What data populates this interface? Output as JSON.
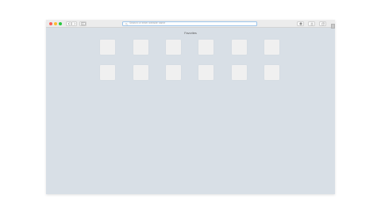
{
  "toolbar": {
    "address_placeholder": "Search or enter website name",
    "icons": {
      "close": "close-light",
      "minimize": "minimize-light",
      "zoom": "zoom-light",
      "back": "chevron-left-icon",
      "forward": "chevron-right-icon",
      "sidebar": "sidebar-icon",
      "search": "magnifier-icon",
      "downloads": "download-icon",
      "share": "share-icon",
      "tabs": "tabs-icon"
    }
  },
  "favorites": {
    "title": "Favorites",
    "tile_count": 12
  },
  "colors": {
    "content_background": "#d8dfe6",
    "toolbar_background": "#ececec",
    "tile_background": "#f0f0f0",
    "address_focus_ring": "#9cc4ea"
  }
}
